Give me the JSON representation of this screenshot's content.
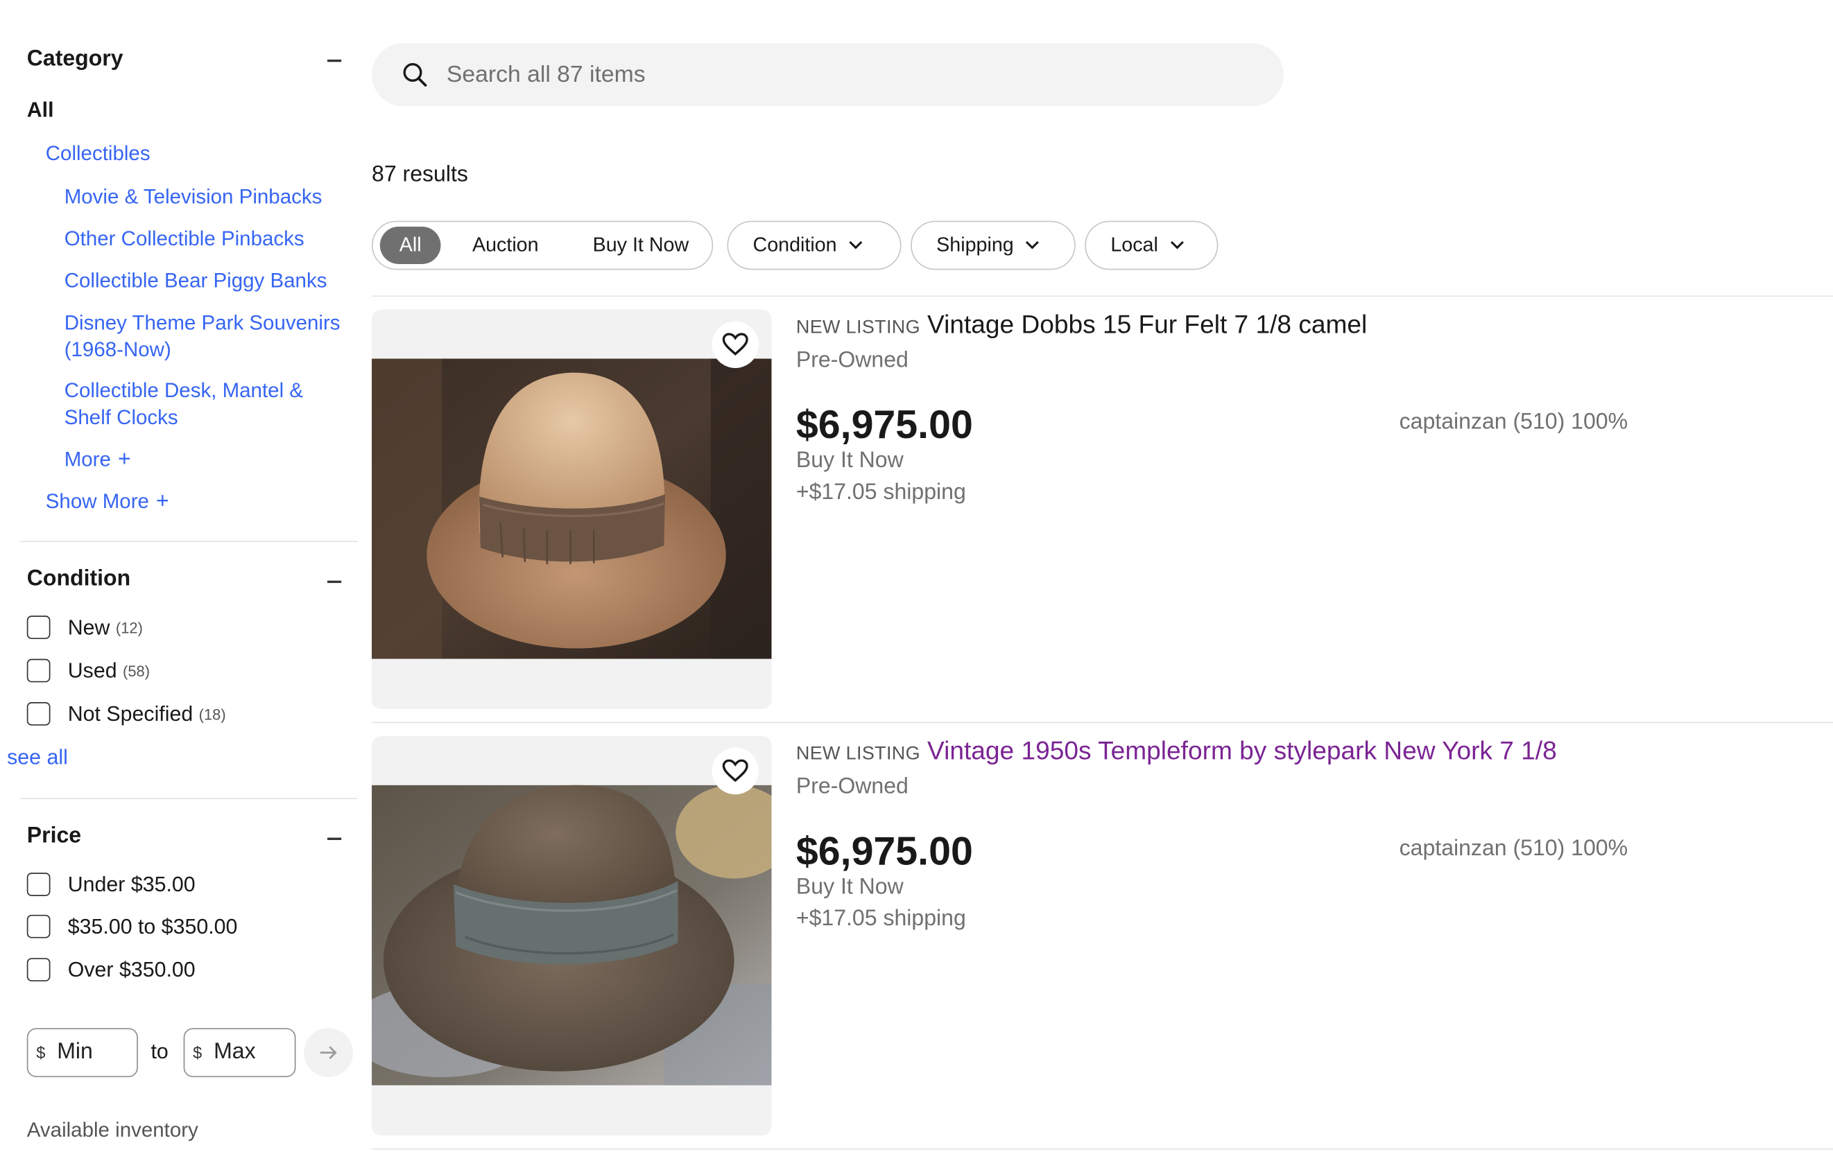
{
  "search": {
    "placeholder": "Search all 87 items"
  },
  "results_count": "87 results",
  "sidebar": {
    "category": {
      "heading": "Category",
      "all": "All",
      "parent": "Collectibles",
      "items": [
        "Movie & Television Pinbacks",
        "Other Collectible Pinbacks",
        "Collectible Bear Piggy Banks",
        "Disney Theme Park Souvenirs (1968-Now)",
        "Collectible Desk, Mantel & Shelf Clocks"
      ],
      "more": "More",
      "show_more": "Show More"
    },
    "condition": {
      "heading": "Condition",
      "options": [
        {
          "label": "New",
          "count": "(12)"
        },
        {
          "label": "Used",
          "count": "(58)"
        },
        {
          "label": "Not Specified",
          "count": "(18)"
        }
      ],
      "see_all": "see all"
    },
    "price": {
      "heading": "Price",
      "options": [
        "Under $35.00",
        "$35.00 to $350.00",
        "Over $350.00"
      ],
      "currency": "$",
      "min_placeholder": "Min",
      "to": "to",
      "max_placeholder": "Max"
    },
    "available_inventory": "Available inventory"
  },
  "filters": {
    "all": "All",
    "auction": "Auction",
    "buy_it_now": "Buy It Now",
    "condition": "Condition",
    "shipping": "Shipping",
    "local": "Local"
  },
  "listings": [
    {
      "badge": "NEW LISTING",
      "title": "Vintage Dobbs 15 Fur Felt 7 1/8 camel",
      "condition": "Pre-Owned",
      "price": "$6,975.00",
      "format": "Buy It Now",
      "shipping": "+$17.05 shipping",
      "seller": "captainzan (510) 100%"
    },
    {
      "badge": "NEW LISTING",
      "title": "Vintage 1950s Templeform by stylepark New York 7 1/8",
      "condition": "Pre-Owned",
      "price": "$6,975.00",
      "format": "Buy It Now",
      "shipping": "+$17.05 shipping",
      "seller": "captainzan (510) 100%"
    }
  ],
  "colors": {
    "link": "#3665f3",
    "visited": "#7a2493",
    "muted": "#707070"
  }
}
